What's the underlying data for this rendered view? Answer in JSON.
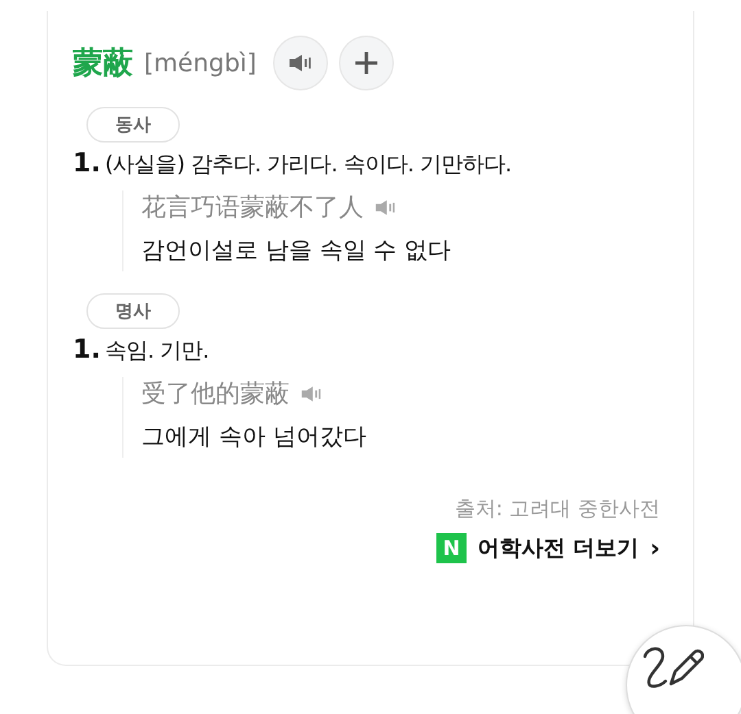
{
  "entry": {
    "headword": "蒙蔽",
    "pronunciation": "[méngbì]"
  },
  "senses": [
    {
      "part_of_speech": "동사",
      "definitions": [
        {
          "number": "1.",
          "text": "(사실을) 감추다. 가리다. 속이다. 기만하다.",
          "examples": [
            {
              "chinese": "花言巧语蒙蔽不了人",
              "korean": "감언이설로 남을 속일 수 없다"
            }
          ]
        }
      ]
    },
    {
      "part_of_speech": "명사",
      "definitions": [
        {
          "number": "1.",
          "text": "속임. 기만.",
          "examples": [
            {
              "chinese": "受了他的蒙蔽",
              "korean": "그에게 속아 넘어갔다"
            }
          ]
        }
      ]
    }
  ],
  "source": "출처: 고려대 중한사전",
  "more_link": {
    "logo": "N",
    "label": "어학사전 더보기",
    "chevron": "›"
  }
}
